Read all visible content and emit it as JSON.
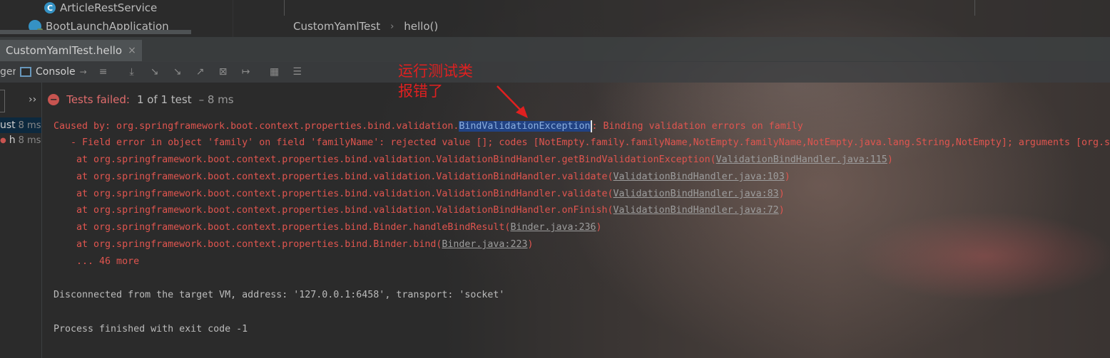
{
  "project_tree": {
    "items": [
      {
        "label": "ArticleRestService",
        "icon": "class-icon"
      },
      {
        "label": "BootLaunchApplication",
        "icon": "spring-boot-class-icon"
      }
    ]
  },
  "breadcrumb": {
    "items": [
      "CustomYamlTest",
      "hello()"
    ]
  },
  "run_tab": {
    "label": "CustomYamlTest.hello",
    "close": "×"
  },
  "toolbar": {
    "left_partial": "ger",
    "console_label": "Console"
  },
  "status": {
    "expand": "››",
    "label": "Tests failed:",
    "count": "1 of 1 test",
    "time": "– 8 ms"
  },
  "test_tree": {
    "items": [
      {
        "name": "ust",
        "time": "8 ms"
      },
      {
        "name": "h",
        "time": "8 ms"
      }
    ]
  },
  "console": {
    "line1_prefix": "Caused by: org.springframework.boot.context.properties.bind.validation.",
    "line1_highlight": "BindValidationException",
    "line1_suffix": ": Binding validation errors on family",
    "line2": "   - Field error in object 'family' on field 'familyName': rejected value []; codes [NotEmpty.family.familyName,NotEmpty.familyName,NotEmpty.java.lang.String,NotEmpty]; arguments [org.s",
    "stack": [
      {
        "text": "    at org.springframework.boot.context.properties.bind.validation.ValidationBindHandler.getBindValidationException(",
        "link": "ValidationBindHandler.java:115",
        "close": ")"
      },
      {
        "text": "    at org.springframework.boot.context.properties.bind.validation.ValidationBindHandler.validate(",
        "link": "ValidationBindHandler.java:103",
        "close": ")"
      },
      {
        "text": "    at org.springframework.boot.context.properties.bind.validation.ValidationBindHandler.validate(",
        "link": "ValidationBindHandler.java:83",
        "close": ")"
      },
      {
        "text": "    at org.springframework.boot.context.properties.bind.validation.ValidationBindHandler.onFinish(",
        "link": "ValidationBindHandler.java:72",
        "close": ")"
      },
      {
        "text": "    at org.springframework.boot.context.properties.bind.Binder.handleBindResult(",
        "link": "Binder.java:236",
        "close": ")"
      },
      {
        "text": "    at org.springframework.boot.context.properties.bind.Binder.bind(",
        "link": "Binder.java:223",
        "close": ")"
      }
    ],
    "more": "    ... 46 more",
    "disconnected": "Disconnected from the target VM, address: '127.0.0.1:6458', transport: 'socket'",
    "finished": "Process finished with exit code -1"
  },
  "annotation": {
    "line1": "运行测试类",
    "line2": "报错了",
    "color": "#e02020"
  },
  "colors": {
    "error_text": "#e0554f",
    "highlight_bg": "#214283",
    "console_bg": "#2b2b2b"
  }
}
